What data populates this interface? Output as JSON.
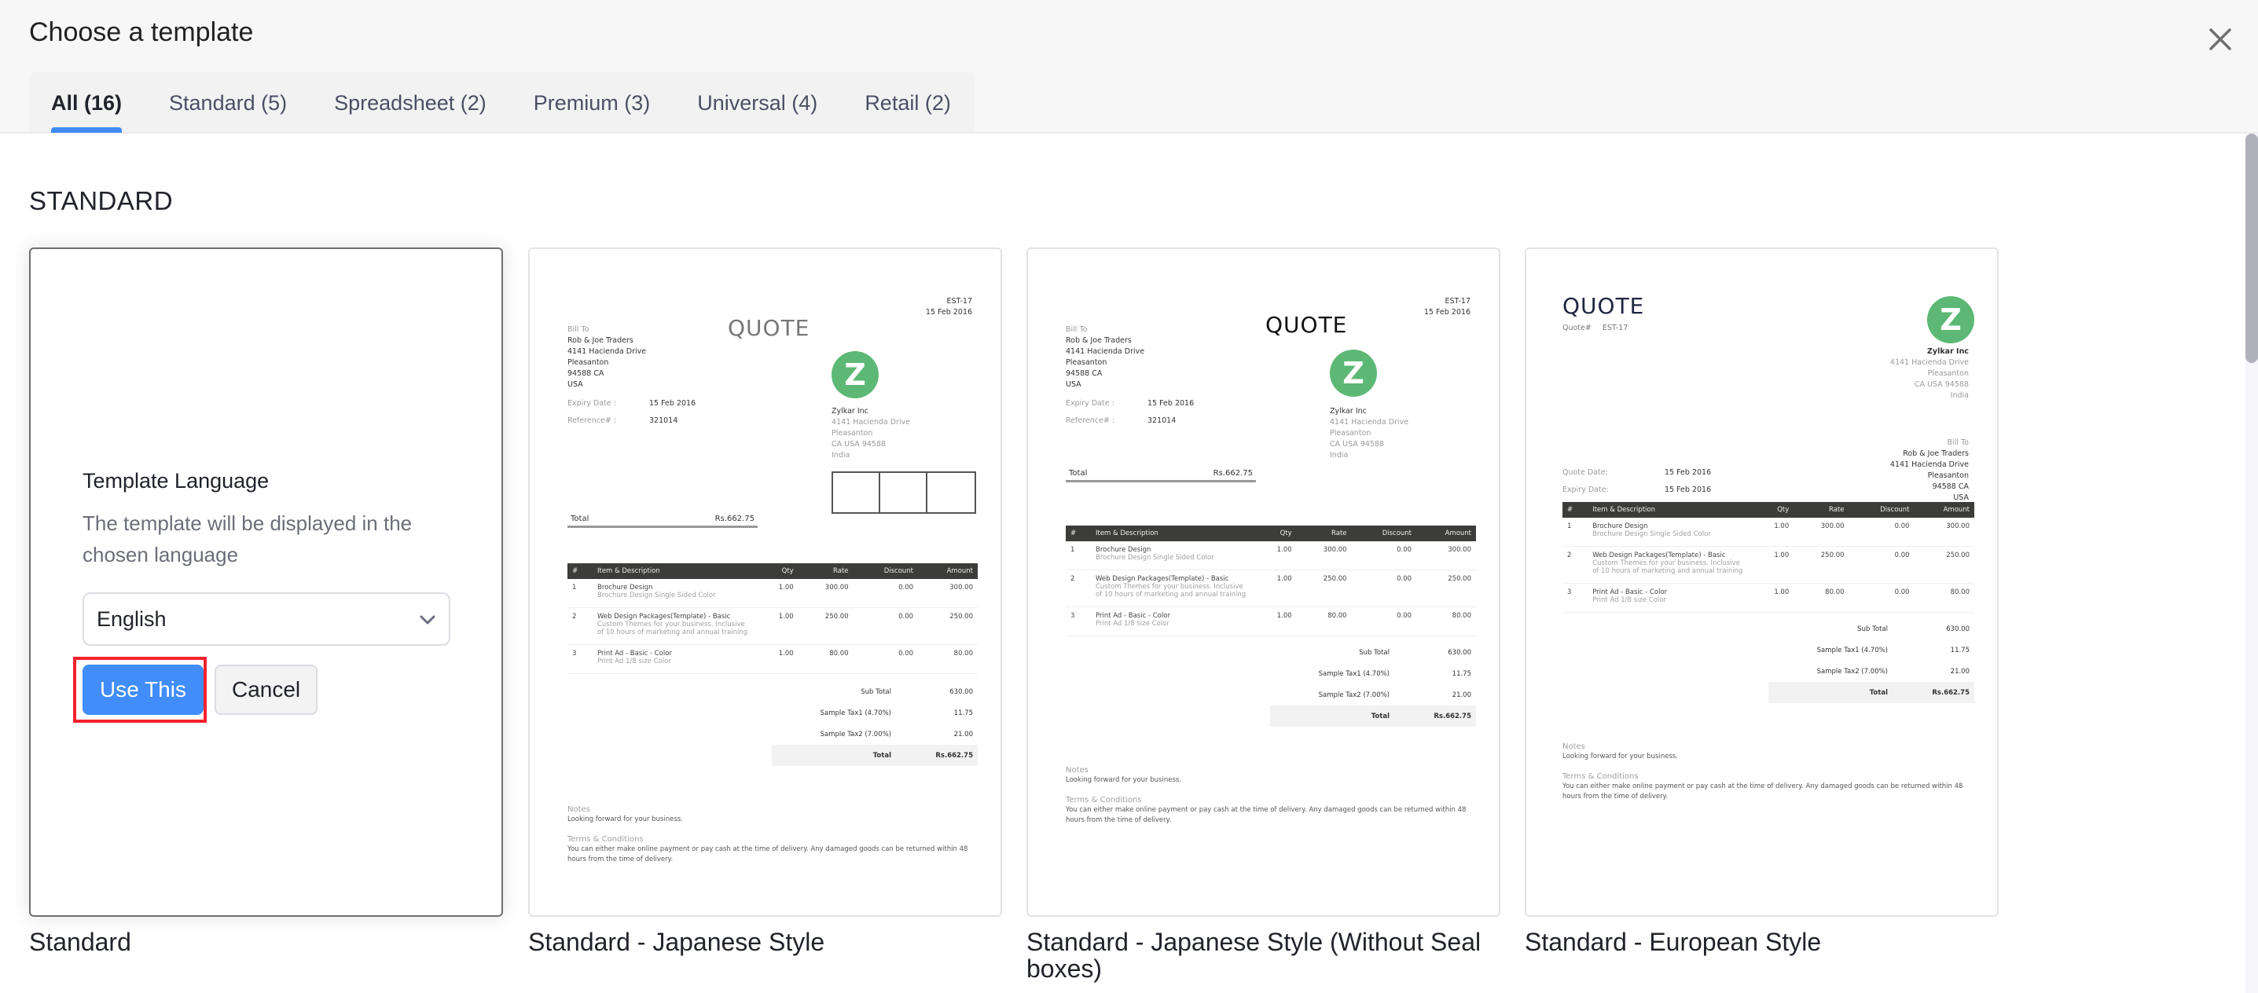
{
  "dialog": {
    "title": "Choose a template",
    "close_icon": "close-icon"
  },
  "tabs": [
    {
      "label": "All (16)",
      "active": true
    },
    {
      "label": "Standard (5)",
      "active": false
    },
    {
      "label": "Spreadsheet (2)",
      "active": false
    },
    {
      "label": "Premium (3)",
      "active": false
    },
    {
      "label": "Universal (4)",
      "active": false
    },
    {
      "label": "Retail (2)",
      "active": false
    }
  ],
  "section": {
    "title": "STANDARD"
  },
  "language_panel": {
    "title": "Template Language",
    "description": "The template will be displayed in the chosen language",
    "selected_language": "English",
    "use_button": "Use This",
    "cancel_button": "Cancel"
  },
  "templates": [
    {
      "name": "Standard"
    },
    {
      "name": "Standard - Japanese Style"
    },
    {
      "name": "Standard - Japanese Style (Without Seal boxes)"
    },
    {
      "name": "Standard - European Style"
    }
  ],
  "quote": {
    "heading": "QUOTE",
    "number": "EST-17",
    "quote_number_label": "Quote#",
    "date": "15 Feb 2016",
    "bill_to_label": "Bill To",
    "bill_to": [
      "Rob & Joe Traders",
      "4141 Hacienda Drive",
      "Pleasanton",
      "94588 CA",
      "USA"
    ],
    "quote_date_label": "Quote Date:",
    "expiry_label": "Expiry Date :",
    "expiry_label_eu": "Expiry Date:",
    "expiry_date": "15 Feb 2016",
    "reference_label": "Reference# :",
    "reference": "321014",
    "company_logo_letter": "Z",
    "company": [
      "Zylkar Inc",
      "4141 Hacienda Drive",
      "Pleasanton",
      "CA USA 94588",
      "India"
    ],
    "total_label": "Total",
    "total_value": "Rs.662.75",
    "columns": [
      "#",
      "Item & Description",
      "Qty",
      "Rate",
      "Discount",
      "Amount"
    ],
    "items": [
      {
        "n": "1",
        "name": "Brochure Design",
        "desc": "Brochure Design Single Sided Color",
        "qty": "1.00",
        "rate": "300.00",
        "discount": "0.00",
        "amount": "300.00"
      },
      {
        "n": "2",
        "name": "Web Design Packages(Template) - Basic",
        "desc": "Custom Themes for your business. Inclusive of 10 hours of marketing and annual training",
        "qty": "1.00",
        "rate": "250.00",
        "discount": "0.00",
        "amount": "250.00"
      },
      {
        "n": "3",
        "name": "Print Ad - Basic - Color",
        "desc": "Print Ad 1/8 size Color",
        "qty": "1.00",
        "rate": "80.00",
        "discount": "0.00",
        "amount": "80.00"
      }
    ],
    "sub_total_label": "Sub Total",
    "sub_total": "630.00",
    "tax1_label": "Sample Tax1 (4.70%)",
    "tax1": "11.75",
    "tax2_label": "Sample Tax2 (7.00%)",
    "tax2": "21.00",
    "notes_label": "Notes",
    "notes": "Looking forward for your business.",
    "terms_label": "Terms & Conditions",
    "terms": "You can either make online payment or pay cash at the time of delivery. Any damaged goods can be returned within 48 hours from the time of delivery."
  },
  "colors": {
    "accent": "#408dfb",
    "highlight_border": "#f5222d",
    "logo_green": "#5cb874",
    "table_header": "#3c3d3a"
  }
}
